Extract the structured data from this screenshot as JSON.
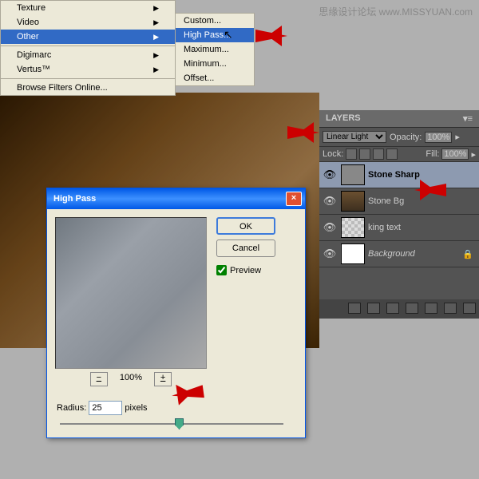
{
  "watermark": "思缘设计论坛 www.MISSYUAN.com",
  "menu1": {
    "items": [
      "Texture",
      "Video",
      "Other",
      "",
      "Digimarc",
      "Vertus™",
      "",
      "Browse Filters Online..."
    ],
    "highlight": "Other"
  },
  "menu2": {
    "items": [
      "Custom...",
      "High Pass...",
      "Maximum...",
      "Minimum...",
      "Offset..."
    ],
    "highlight": "High Pass..."
  },
  "dialog": {
    "title": "High Pass",
    "ok": "OK",
    "cancel": "Cancel",
    "preview": "Preview",
    "zoom": "100%",
    "radius_label": "Radius:",
    "radius_value": "25",
    "radius_unit": "pixels",
    "minus": "−",
    "plus": "+"
  },
  "layers": {
    "title": "LAYERS",
    "blend": "Linear Light",
    "opacity_label": "Opacity:",
    "opacity": "100%",
    "lock_label": "Lock:",
    "fill_label": "Fill:",
    "fill": "100%",
    "rows": [
      {
        "name": "Stone Sharp"
      },
      {
        "name": "Stone Bg"
      },
      {
        "name": "king text"
      },
      {
        "name": "Background"
      }
    ]
  }
}
